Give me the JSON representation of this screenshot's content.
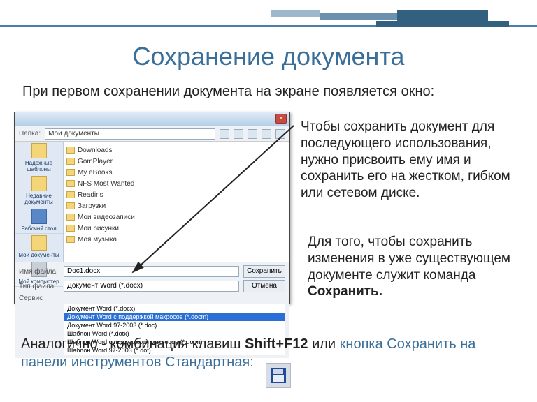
{
  "title": "Сохранение документа",
  "intro": "При первом сохранении документа на экране появляется  окно:",
  "para1": "Чтобы сохранить документ для последующего использования, нужно присвоить ему имя и сохранить его на жестком, гибком или сетевом диске.",
  "para2_pre": "Для того, чтобы сохранить изменения в уже существующем документе служит команда ",
  "para2_bold": "Сохранить.",
  "para3_a": "Аналогично - комбинация клавиш ",
  "para3_b": "Shift+F12",
  "para3_c": " или ",
  "para3_d": "кнопка Сохранить  на панели инструментов Стандартная:",
  "dialog": {
    "close": "×",
    "path_label": "Папка:",
    "path_value": "Мои документы",
    "sidebar": [
      "Надежные шаблоны",
      "Недавние документы",
      "Рабочий стол",
      "Мои документы",
      "Мой компьютер"
    ],
    "folders": [
      "Downloads",
      "GomPlayer",
      "My eBooks",
      "NFS Most Wanted",
      "Readiris",
      "Загрузки",
      "Мои видеозаписи",
      "Мои рисунки",
      "Моя музыка"
    ],
    "fname_label": "Имя файла:",
    "fname_value": "Doc1.docx",
    "ftype_label": "Тип файла:",
    "ftype_value": "Документ Word (*.docx)",
    "save": "Сохранить",
    "cancel": "Отмена",
    "service": "Сервис",
    "type_options": [
      "Документ Word (*.docx)",
      "Документ Word с поддержкой макросов (*.docm)",
      "Документ Word 97-2003 (*.doc)",
      "Шаблон Word (*.dotx)",
      "Шаблон Word с поддержкой макросов (*.dotm)",
      "Шаблон Word 97-2003 (*.dot)"
    ],
    "type_selected_index": 1
  }
}
